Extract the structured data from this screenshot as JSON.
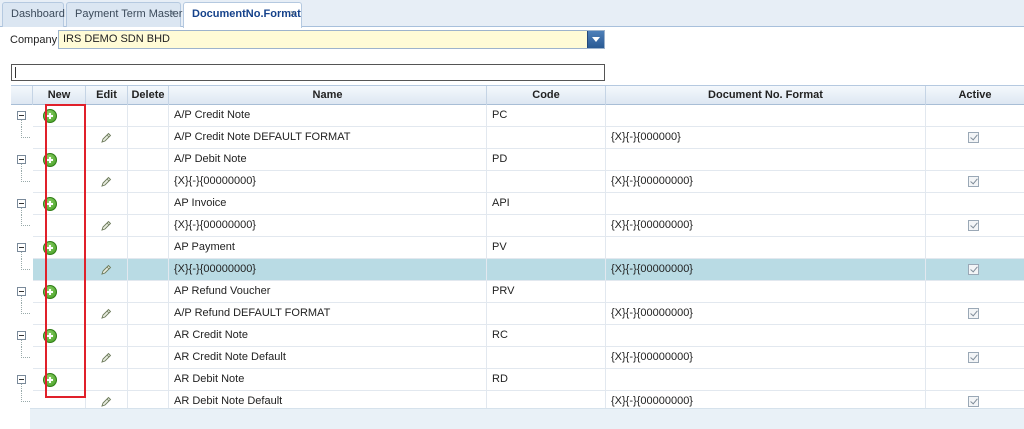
{
  "tabs": [
    {
      "label": "Dashboard",
      "closable": false,
      "active": false
    },
    {
      "label": "Payment Term Master",
      "closable": true,
      "active": false
    },
    {
      "label": "DocumentNo.Format",
      "closable": true,
      "active": true
    }
  ],
  "close_glyph": "×",
  "company": {
    "label": "Company:",
    "value": "IRS DEMO SDN BHD"
  },
  "search": {
    "value": ""
  },
  "grid": {
    "columns": [
      "New",
      "Edit",
      "Delete",
      "Name",
      "Code",
      "Document No. Format",
      "Active"
    ],
    "rows": [
      {
        "type": "parent",
        "name": "A/P Credit Note",
        "code": "PC",
        "format": "",
        "active": false
      },
      {
        "type": "child",
        "name": "A/P Credit Note DEFAULT FORMAT",
        "code": "",
        "format": "{X}{-}{000000}",
        "active": true
      },
      {
        "type": "parent",
        "name": "A/P Debit Note",
        "code": "PD",
        "format": "",
        "active": false
      },
      {
        "type": "child",
        "name": "{X}{-}{00000000}",
        "code": "",
        "format": "{X}{-}{00000000}",
        "active": true
      },
      {
        "type": "parent",
        "name": "AP Invoice",
        "code": "API",
        "format": "",
        "active": false
      },
      {
        "type": "child",
        "name": "{X}{-}{00000000}",
        "code": "",
        "format": "{X}{-}{00000000}",
        "active": true
      },
      {
        "type": "parent",
        "name": "AP Payment",
        "code": "PV",
        "format": "",
        "active": false
      },
      {
        "type": "child",
        "name": "{X}{-}{00000000}",
        "code": "",
        "format": "{X}{-}{00000000}",
        "active": true,
        "selected": true
      },
      {
        "type": "parent",
        "name": "AP Refund Voucher",
        "code": "PRV",
        "format": "",
        "active": false
      },
      {
        "type": "child",
        "name": "A/P Refund DEFAULT FORMAT",
        "code": "",
        "format": "{X}{-}{00000000}",
        "active": true
      },
      {
        "type": "parent",
        "name": "AR Credit Note",
        "code": "RC",
        "format": "",
        "active": false
      },
      {
        "type": "child",
        "name": "AR Credit Note Default",
        "code": "",
        "format": "{X}{-}{00000000}",
        "active": true
      },
      {
        "type": "parent",
        "name": "AR Debit Note",
        "code": "RD",
        "format": "",
        "active": false
      },
      {
        "type": "child",
        "name": "AR Debit Note Default",
        "code": "",
        "format": "{X}{-}{00000000}",
        "active": true
      }
    ]
  },
  "colors": {
    "accent": "#15428b",
    "selected_row": "#b9dbe4",
    "highlight": "#e0202a",
    "add_icon": "#3f9a1f"
  }
}
